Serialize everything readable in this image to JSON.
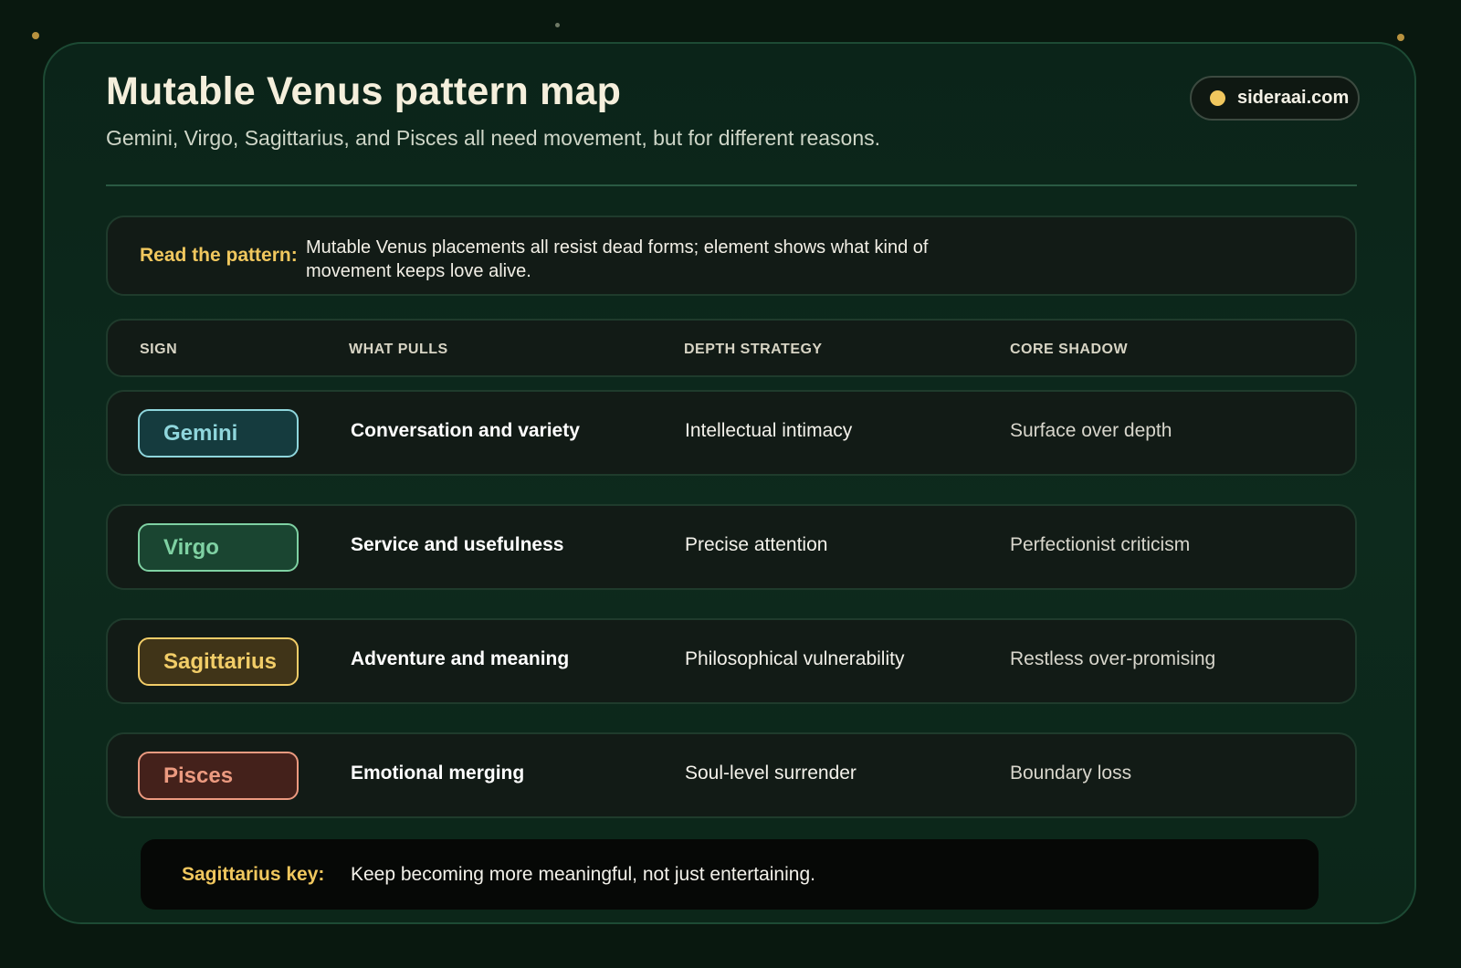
{
  "header": {
    "title": "Mutable Venus pattern map",
    "subtitle": "Gemini, Virgo, Sagittarius, and Pisces all need movement, but for different reasons.",
    "brand": "sideraai.com"
  },
  "pattern": {
    "label": "Read the pattern:",
    "text": "Mutable Venus placements all resist dead forms; element shows what kind of movement keeps love alive."
  },
  "table": {
    "columns": [
      "SIGN",
      "WHAT PULLS",
      "DEPTH STRATEGY",
      "CORE SHADOW"
    ],
    "rows": [
      {
        "sign": "Gemini",
        "pulls": "Conversation and variety",
        "depth": "Intellectual intimacy",
        "shadow": "Surface over depth"
      },
      {
        "sign": "Virgo",
        "pulls": "Service and usefulness",
        "depth": "Precise attention",
        "shadow": "Perfectionist criticism"
      },
      {
        "sign": "Sagittarius",
        "pulls": "Adventure and meaning",
        "depth": "Philosophical vulnerability",
        "shadow": "Restless over-promising"
      },
      {
        "sign": "Pisces",
        "pulls": "Emotional merging",
        "depth": "Soul-level surrender",
        "shadow": "Boundary loss"
      }
    ]
  },
  "key": {
    "label": "Sagittarius key:",
    "text": "Keep becoming more meaningful, not just entertaining."
  },
  "colors": {
    "background": "#09180f",
    "accent_gold": "#f0c75e",
    "gemini_text": "#8fd6dc",
    "gemini_fill": "#153b3e",
    "virgo_text": "#7fd1a3",
    "virgo_fill": "#1a4531",
    "sagittarius_text": "#f2cd68",
    "sagittarius_fill": "#403418",
    "pisces_text": "#ec9a80",
    "pisces_fill": "#44211b"
  }
}
